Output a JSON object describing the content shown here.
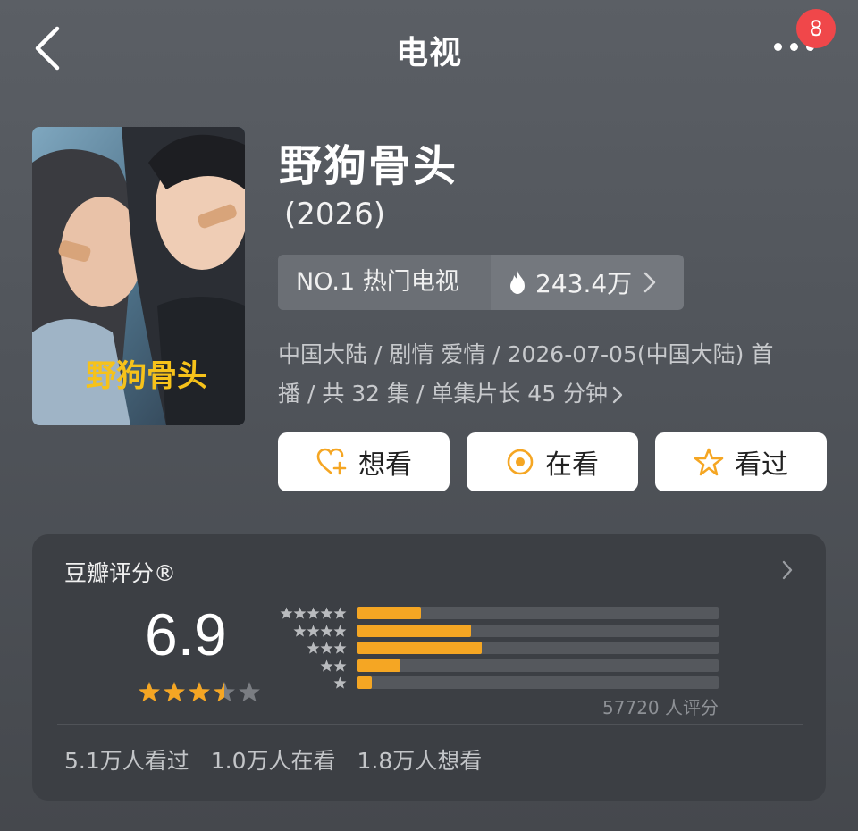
{
  "header": {
    "title": "电视",
    "back_icon": "chevron-left-icon",
    "more_icon": "more-dots-icon",
    "badge": "8"
  },
  "show": {
    "title": "野狗骨头",
    "year": "(2026)",
    "rank_label": "NO.1 热门电视",
    "heat": "243.4万",
    "meta_line1": "中国大陆 / 剧情 爱情 / 2026-07-05(中国大陆) 首",
    "meta_line2": "播 / 共 32 集 / 单集片长 45 分钟",
    "poster_text": "野狗骨头"
  },
  "actions": [
    {
      "label": "想看",
      "icon": "heart-plus-icon"
    },
    {
      "label": "在看",
      "icon": "target-icon"
    },
    {
      "label": "看过",
      "icon": "star-outline-icon"
    }
  ],
  "rating": {
    "title": "豆瓣评分®",
    "score": "6.9",
    "score_stars": 3.5,
    "distribution": [
      {
        "stars": 5,
        "fraction": 0.175
      },
      {
        "stars": 4,
        "fraction": 0.315
      },
      {
        "stars": 3,
        "fraction": 0.345
      },
      {
        "stars": 2,
        "fraction": 0.12
      },
      {
        "stars": 1,
        "fraction": 0.04
      }
    ],
    "count": "57720 人评分",
    "stats": [
      "5.1万人看过",
      "1.0万人在看",
      "1.8万人想看"
    ]
  },
  "colors": {
    "accent": "#f5a623",
    "badge": "#f0474a",
    "card": "#3c3f44"
  }
}
